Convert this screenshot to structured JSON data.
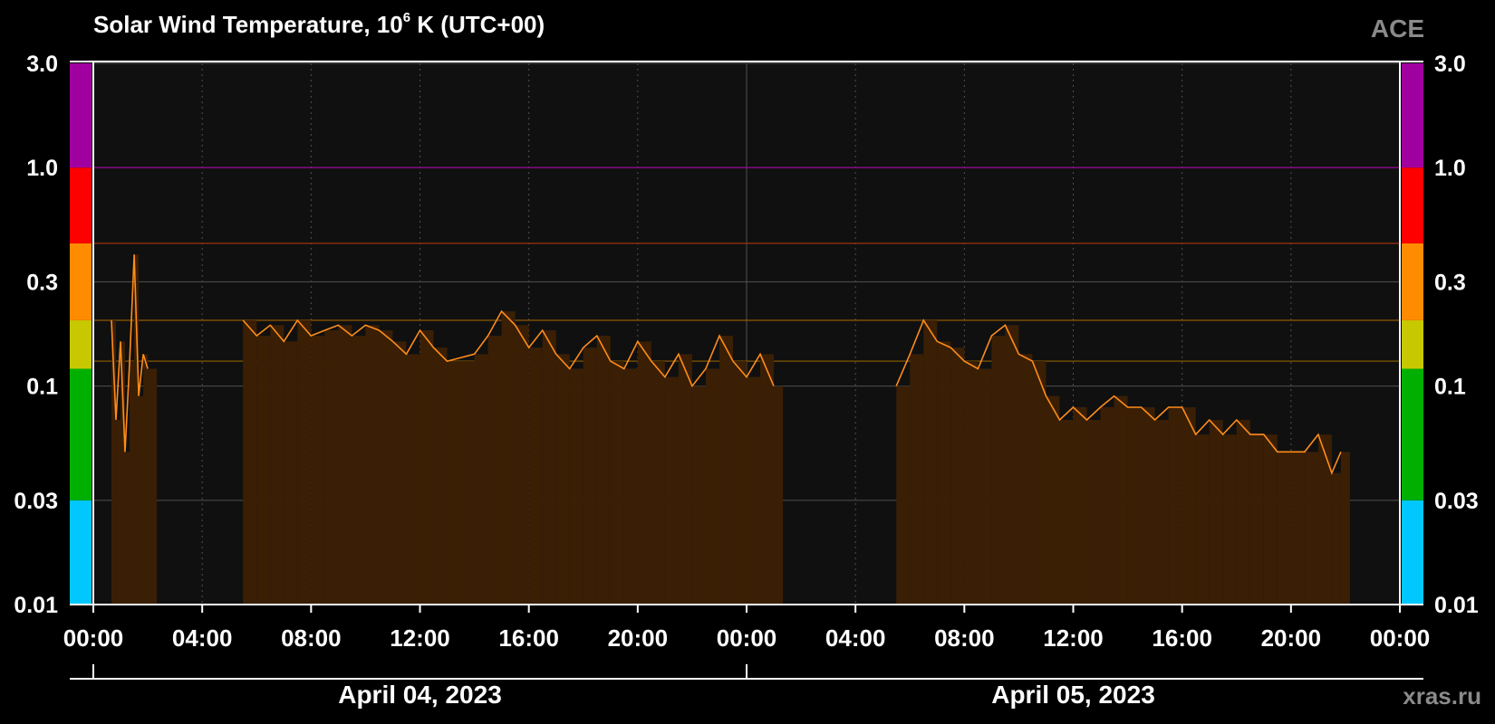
{
  "header": {
    "title_pre": "Solar Wind Temperature, 10",
    "title_sup": "6",
    "title_post": " K (UTC+00)",
    "source": "ACE",
    "site": "xras.ru"
  },
  "colors": {
    "background": "#000000",
    "plot_bg": "#101010",
    "bar_fill": "#3a1f05",
    "line": "#ff8c1a",
    "axis": "#ffffff",
    "grid": "#505050",
    "scale_bands": [
      "#00c8ff",
      "#00b000",
      "#c8c800",
      "#ff8c00",
      "#ff0000",
      "#a000a0"
    ]
  },
  "chart_data": {
    "type": "area",
    "title": "Solar Wind Temperature, 10^6 K (UTC+00)",
    "y_scale": "log",
    "ylim": [
      0.01,
      3.0
    ],
    "y_ticks": [
      "3.0",
      "1.0",
      "0.3",
      "0.1",
      "0.03",
      "0.01"
    ],
    "y_tick_values": [
      3.0,
      1.0,
      0.3,
      0.1,
      0.03,
      0.01
    ],
    "xlim": [
      "2023-04-04 00:00",
      "2023-04-06 00:00"
    ],
    "x_ticks": [
      "00:00",
      "04:00",
      "08:00",
      "12:00",
      "16:00",
      "20:00",
      "00:00",
      "04:00",
      "08:00",
      "12:00",
      "16:00",
      "20:00",
      "00:00"
    ],
    "date_labels": [
      "April 04, 2023",
      "April 05, 2023"
    ],
    "threshold_levels": [
      1.0,
      0.45,
      0.2,
      0.13
    ],
    "scale_band_bounds": [
      0.01,
      0.03,
      0.12,
      0.2,
      0.45,
      1.0,
      3.0
    ],
    "series": [
      {
        "points": [
          [
            "2023-04-04 00:40",
            0.2
          ],
          [
            "2023-04-04 00:50",
            0.07
          ],
          [
            "2023-04-04 01:00",
            0.16
          ],
          [
            "2023-04-04 01:10",
            0.05
          ],
          [
            "2023-04-04 01:20",
            0.13
          ],
          [
            "2023-04-04 01:30",
            0.4
          ],
          [
            "2023-04-04 01:40",
            0.09
          ],
          [
            "2023-04-04 01:50",
            0.14
          ],
          [
            "2023-04-04 02:00",
            0.12
          ],
          [
            "2023-04-04 05:30",
            0.2
          ],
          [
            "2023-04-04 06:00",
            0.17
          ],
          [
            "2023-04-04 06:30",
            0.19
          ],
          [
            "2023-04-04 07:00",
            0.16
          ],
          [
            "2023-04-04 07:30",
            0.2
          ],
          [
            "2023-04-04 08:00",
            0.17
          ],
          [
            "2023-04-04 08:30",
            0.18
          ],
          [
            "2023-04-04 09:00",
            0.19
          ],
          [
            "2023-04-04 09:30",
            0.17
          ],
          [
            "2023-04-04 10:00",
            0.19
          ],
          [
            "2023-04-04 10:30",
            0.18
          ],
          [
            "2023-04-04 11:00",
            0.16
          ],
          [
            "2023-04-04 11:30",
            0.14
          ],
          [
            "2023-04-04 12:00",
            0.18
          ],
          [
            "2023-04-04 12:30",
            0.15
          ],
          [
            "2023-04-04 13:00",
            0.13
          ],
          [
            "2023-04-04 14:00",
            0.14
          ],
          [
            "2023-04-04 14:30",
            0.17
          ],
          [
            "2023-04-04 15:00",
            0.22
          ],
          [
            "2023-04-04 15:30",
            0.19
          ],
          [
            "2023-04-04 16:00",
            0.15
          ],
          [
            "2023-04-04 16:30",
            0.18
          ],
          [
            "2023-04-04 17:00",
            0.14
          ],
          [
            "2023-04-04 17:30",
            0.12
          ],
          [
            "2023-04-04 18:00",
            0.15
          ],
          [
            "2023-04-04 18:30",
            0.17
          ],
          [
            "2023-04-04 19:00",
            0.13
          ],
          [
            "2023-04-04 19:30",
            0.12
          ],
          [
            "2023-04-04 20:00",
            0.16
          ],
          [
            "2023-04-04 20:30",
            0.13
          ],
          [
            "2023-04-04 21:00",
            0.11
          ],
          [
            "2023-04-04 21:30",
            0.14
          ],
          [
            "2023-04-04 22:00",
            0.1
          ],
          [
            "2023-04-04 22:30",
            0.12
          ],
          [
            "2023-04-04 23:00",
            0.17
          ],
          [
            "2023-04-04 23:30",
            0.13
          ],
          [
            "2023-04-05 00:00",
            0.11
          ],
          [
            "2023-04-05 00:30",
            0.14
          ],
          [
            "2023-04-05 01:00",
            0.1
          ],
          [
            "2023-04-05 05:30",
            0.1
          ],
          [
            "2023-04-05 06:00",
            0.14
          ],
          [
            "2023-04-05 06:30",
            0.2
          ],
          [
            "2023-04-05 07:00",
            0.16
          ],
          [
            "2023-04-05 07:30",
            0.15
          ],
          [
            "2023-04-05 08:00",
            0.13
          ],
          [
            "2023-04-05 08:30",
            0.12
          ],
          [
            "2023-04-05 09:00",
            0.17
          ],
          [
            "2023-04-05 09:30",
            0.19
          ],
          [
            "2023-04-05 10:00",
            0.14
          ],
          [
            "2023-04-05 10:30",
            0.13
          ],
          [
            "2023-04-05 11:00",
            0.09
          ],
          [
            "2023-04-05 11:30",
            0.07
          ],
          [
            "2023-04-05 12:00",
            0.08
          ],
          [
            "2023-04-05 12:30",
            0.07
          ],
          [
            "2023-04-05 13:00",
            0.08
          ],
          [
            "2023-04-05 13:30",
            0.09
          ],
          [
            "2023-04-05 14:00",
            0.08
          ],
          [
            "2023-04-05 14:30",
            0.08
          ],
          [
            "2023-04-05 15:00",
            0.07
          ],
          [
            "2023-04-05 15:30",
            0.08
          ],
          [
            "2023-04-05 16:00",
            0.08
          ],
          [
            "2023-04-05 16:30",
            0.06
          ],
          [
            "2023-04-05 17:00",
            0.07
          ],
          [
            "2023-04-05 17:30",
            0.06
          ],
          [
            "2023-04-05 18:00",
            0.07
          ],
          [
            "2023-04-05 18:30",
            0.06
          ],
          [
            "2023-04-05 19:00",
            0.06
          ],
          [
            "2023-04-05 19:30",
            0.05
          ],
          [
            "2023-04-05 20:00",
            0.05
          ],
          [
            "2023-04-05 20:30",
            0.05
          ],
          [
            "2023-04-05 21:00",
            0.06
          ],
          [
            "2023-04-05 21:30",
            0.04
          ],
          [
            "2023-04-05 21:50",
            0.05
          ]
        ]
      }
    ]
  }
}
